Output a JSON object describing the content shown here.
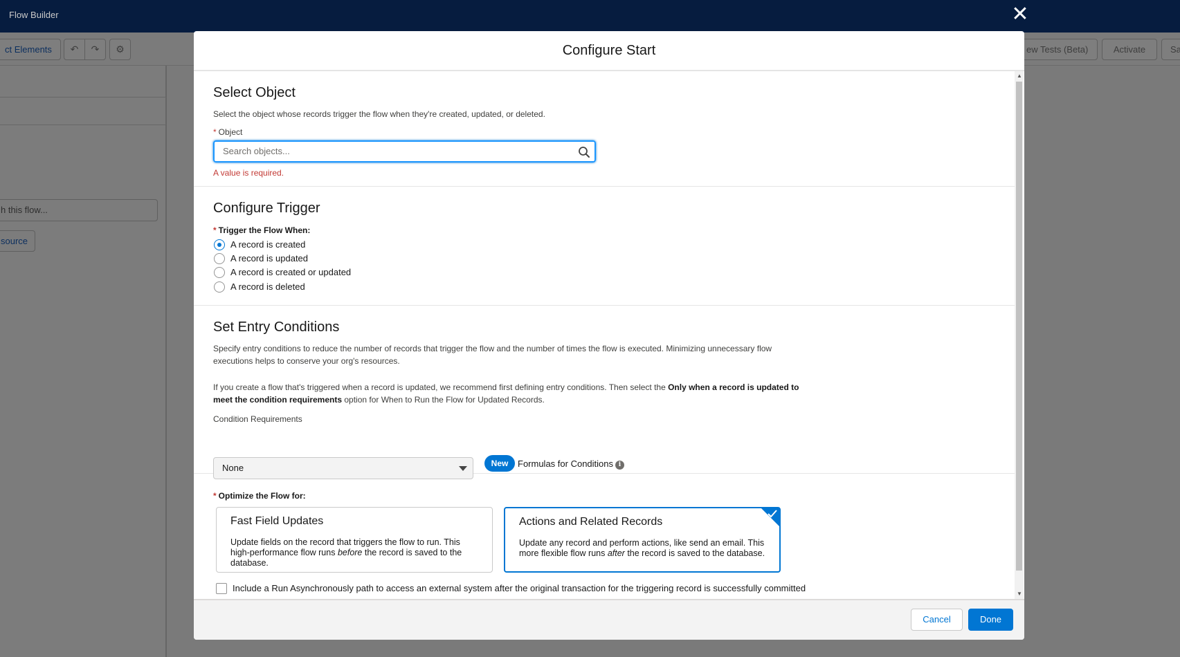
{
  "app": {
    "title": "Flow Builder"
  },
  "toolbar": {
    "select_elements_label": "ct Elements",
    "view_tests_label": "ew Tests (Beta)",
    "activate_label": "Activate",
    "save_label": "Sa"
  },
  "left_panel": {
    "search_placeholder": "h this flow...",
    "new_resource_label": "source"
  },
  "modal": {
    "title": "Configure Start",
    "select_object": {
      "heading": "Select Object",
      "description": "Select the object whose records trigger the flow when they're created, updated, or deleted.",
      "object_label": "Object",
      "required_marker": "*",
      "search_placeholder": "Search objects...",
      "search_value": "",
      "error": "A value is required."
    },
    "configure_trigger": {
      "heading": "Configure Trigger",
      "label": "Trigger the Flow When:",
      "options": [
        {
          "label": "A record is created",
          "checked": true
        },
        {
          "label": "A record is updated",
          "checked": false
        },
        {
          "label": "A record is created or updated",
          "checked": false
        },
        {
          "label": "A record is deleted",
          "checked": false
        }
      ]
    },
    "entry_conditions": {
      "heading": "Set Entry Conditions",
      "description": "Specify entry conditions to reduce the number of records that trigger the flow and the number of times the flow is executed. Minimizing unnecessary flow executions helps to conserve your org's resources.",
      "note_prefix": "If you create a flow that's triggered when a record is updated, we recommend first defining entry conditions. Then select the ",
      "note_bold": "Only when a record is updated to meet the condition requirements",
      "note_suffix": " option for When to Run the Flow for Updated Records.",
      "condition_label": "Condition Requirements",
      "condition_value": "None",
      "new_badge": "New",
      "formula_label": "Formulas for Conditions",
      "info_icon_glyph": "i"
    },
    "optimize": {
      "label": "Optimize the Flow for:",
      "cards": [
        {
          "title": "Fast Field Updates",
          "desc_1": "Update fields on the record that triggers the flow to run. This high-performance flow runs ",
          "desc_em": "before",
          "desc_2": " the record is saved to the database.",
          "selected": false
        },
        {
          "title": "Actions and Related Records",
          "desc_1": "Update any record and perform actions, like send an email. This more flexible flow runs ",
          "desc_em": "after",
          "desc_2": " the record is saved to the database.",
          "selected": true
        }
      ],
      "async_label": "Include a Run Asynchronously path to access an external system after the original transaction for the triggering record is successfully committed"
    },
    "footer": {
      "cancel_label": "Cancel",
      "done_label": "Done"
    }
  },
  "colors": {
    "brand": "#0176d3",
    "error": "#c23934",
    "header_bg": "#061c3f"
  }
}
